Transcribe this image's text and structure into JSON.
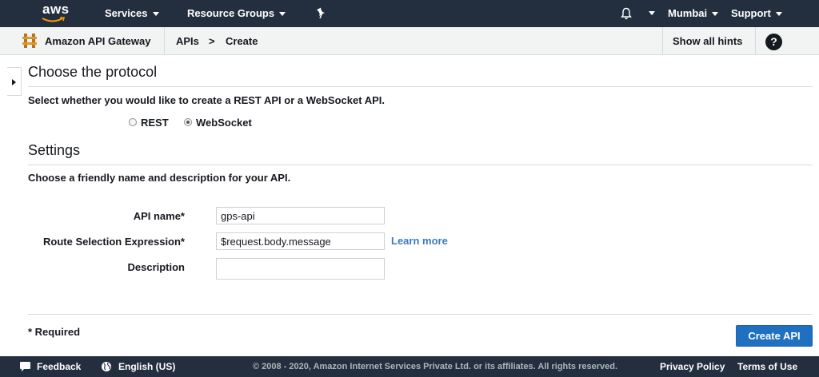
{
  "topnav": {
    "logo_text": "aws",
    "services_label": "Services",
    "resource_groups_label": "Resource Groups",
    "region_label": "Mumbai",
    "support_label": "Support"
  },
  "subbar": {
    "service_name": "Amazon API Gateway",
    "breadcrumb": [
      "APIs",
      ">",
      "Create"
    ],
    "show_hints_label": "Show all hints",
    "help_label": "?"
  },
  "protocol": {
    "heading": "Choose the protocol",
    "description": "Select whether you would like to create a REST API or a WebSocket API.",
    "options": [
      {
        "label": "REST",
        "checked": false
      },
      {
        "label": "WebSocket",
        "checked": true
      }
    ]
  },
  "settings": {
    "heading": "Settings",
    "description": "Choose a friendly name and description for your API.",
    "api_name_label": "API name*",
    "api_name_value": "gps-api",
    "route_label": "Route Selection Expression*",
    "route_value": "$request.body.message",
    "learn_more_label": "Learn more",
    "description_label": "Description",
    "description_value": ""
  },
  "form_footer": {
    "required_note": "* Required",
    "create_button_label": "Create API"
  },
  "footer": {
    "feedback_label": "Feedback",
    "language_label": "English (US)",
    "copyright": "© 2008 - 2020, Amazon Internet Services Private Ltd. or its affiliates. All rights reserved.",
    "privacy_label": "Privacy Policy",
    "terms_label": "Terms of Use"
  },
  "colors": {
    "nav_bg": "#232f3e",
    "primary_button": "#1f70c1",
    "link": "#3b7bbf"
  }
}
